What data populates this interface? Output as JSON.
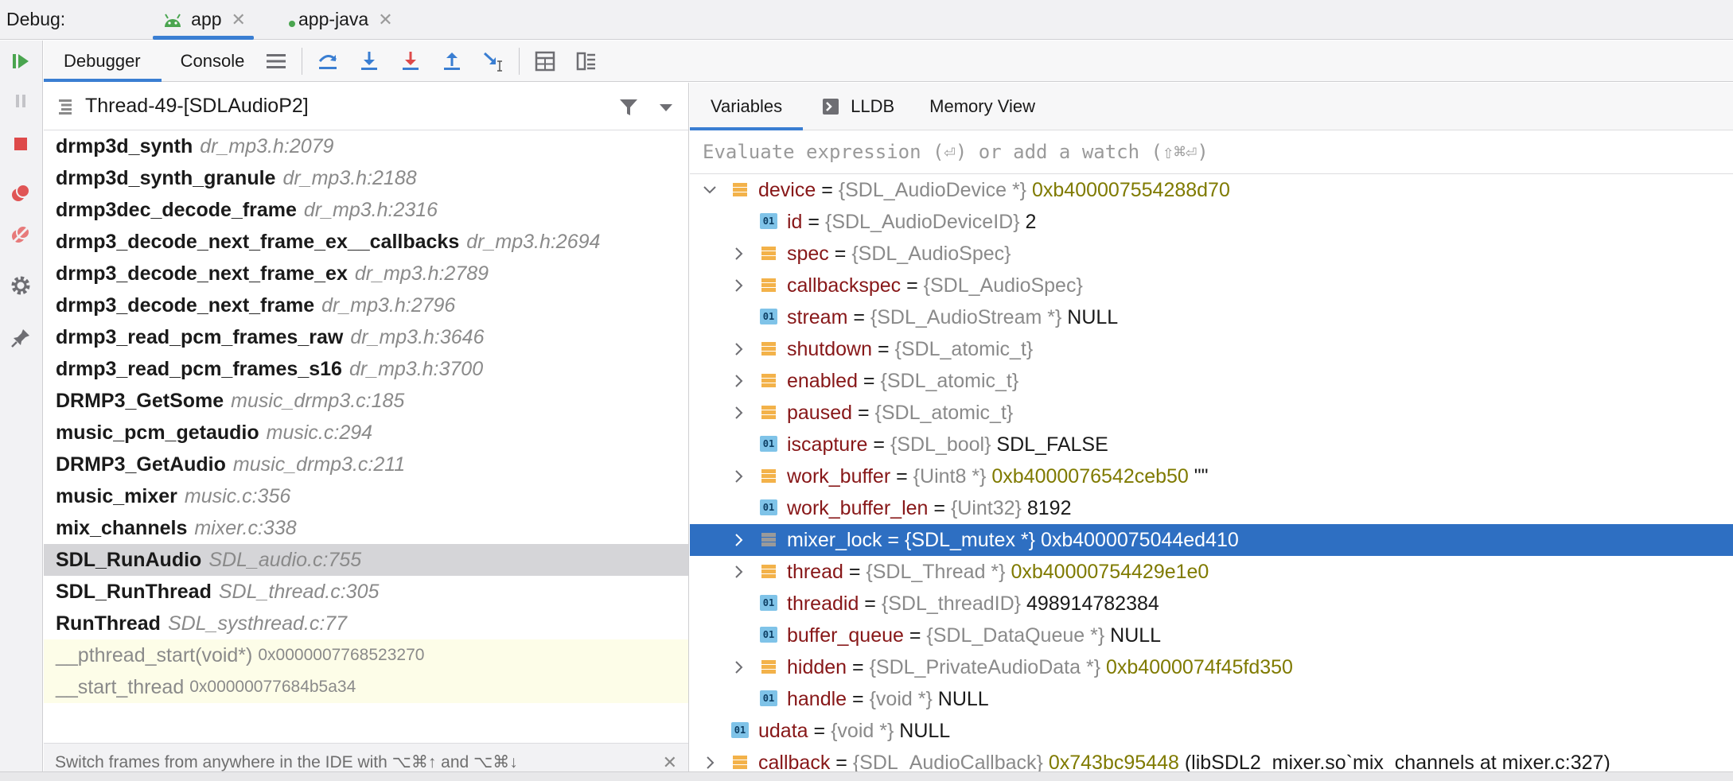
{
  "header": {
    "debug_label": "Debug:",
    "tabs": [
      {
        "label": "app",
        "close": "✕"
      },
      {
        "label": "app-java",
        "close": "✕"
      }
    ]
  },
  "toolbar": {
    "debugger_tab": "Debugger",
    "console_tab": "Console"
  },
  "frames_panel": {
    "thread": "Thread-49-[SDLAudioP2]",
    "frames": [
      {
        "fn": "drmp3d_synth",
        "loc": "dr_mp3.h:2079"
      },
      {
        "fn": "drmp3d_synth_granule",
        "loc": "dr_mp3.h:2188"
      },
      {
        "fn": "drmp3dec_decode_frame",
        "loc": "dr_mp3.h:2316"
      },
      {
        "fn": "drmp3_decode_next_frame_ex__callbacks",
        "loc": "dr_mp3.h:2694"
      },
      {
        "fn": "drmp3_decode_next_frame_ex",
        "loc": "dr_mp3.h:2789"
      },
      {
        "fn": "drmp3_decode_next_frame",
        "loc": "dr_mp3.h:2796"
      },
      {
        "fn": "drmp3_read_pcm_frames_raw",
        "loc": "dr_mp3.h:3646"
      },
      {
        "fn": "drmp3_read_pcm_frames_s16",
        "loc": "dr_mp3.h:3700"
      },
      {
        "fn": "DRMP3_GetSome",
        "loc": "music_drmp3.c:185"
      },
      {
        "fn": "music_pcm_getaudio",
        "loc": "music.c:294"
      },
      {
        "fn": "DRMP3_GetAudio",
        "loc": "music_drmp3.c:211"
      },
      {
        "fn": "music_mixer",
        "loc": "music.c:356"
      },
      {
        "fn": "mix_channels",
        "loc": "mixer.c:338"
      },
      {
        "fn": "SDL_RunAudio",
        "loc": "SDL_audio.c:755"
      },
      {
        "fn": "SDL_RunThread",
        "loc": "SDL_thread.c:305"
      },
      {
        "fn": "RunThread",
        "loc": "SDL_systhread.c:77"
      },
      {
        "fn": "__pthread_start(void*)",
        "loc": "0x0000007768523270"
      },
      {
        "fn": "__start_thread",
        "loc": "0x00000077684b5a34"
      }
    ],
    "hint": "Switch frames from anywhere in the IDE with ⌥⌘↑ and ⌥⌘↓",
    "hint_close": "✕"
  },
  "vars_panel": {
    "tabs": [
      "Variables",
      "LLDB",
      "Memory View"
    ],
    "eval_placeholder": "Evaluate expression (⏎) or add a watch (⇧⌘⏎)",
    "rows": [
      {
        "name": "device",
        "type": "{SDL_AudioDevice *}",
        "addr": "0xb400007554288d70",
        "val": ""
      },
      {
        "name": "id",
        "type": "{SDL_AudioDeviceID}",
        "addr": "",
        "val": "2"
      },
      {
        "name": "spec",
        "type": "{SDL_AudioSpec}",
        "addr": "",
        "val": ""
      },
      {
        "name": "callbackspec",
        "type": "{SDL_AudioSpec}",
        "addr": "",
        "val": ""
      },
      {
        "name": "stream",
        "type": "{SDL_AudioStream *}",
        "addr": "",
        "val": "NULL"
      },
      {
        "name": "shutdown",
        "type": "{SDL_atomic_t}",
        "addr": "",
        "val": ""
      },
      {
        "name": "enabled",
        "type": "{SDL_atomic_t}",
        "addr": "",
        "val": ""
      },
      {
        "name": "paused",
        "type": "{SDL_atomic_t}",
        "addr": "",
        "val": ""
      },
      {
        "name": "iscapture",
        "type": "{SDL_bool}",
        "addr": "",
        "val": "SDL_FALSE"
      },
      {
        "name": "work_buffer",
        "type": "{Uint8 *}",
        "addr": "0xb4000076542ceb50",
        "val": "\"\""
      },
      {
        "name": "work_buffer_len",
        "type": "{Uint32}",
        "addr": "",
        "val": "8192"
      },
      {
        "name": "mixer_lock",
        "type": "{SDL_mutex *}",
        "addr": "0xb4000075044ed410",
        "val": ""
      },
      {
        "name": "thread",
        "type": "{SDL_Thread *}",
        "addr": "0xb40000754429e1e0",
        "val": ""
      },
      {
        "name": "threadid",
        "type": "{SDL_threadID}",
        "addr": "",
        "val": "498914782384"
      },
      {
        "name": "buffer_queue",
        "type": "{SDL_DataQueue *}",
        "addr": "",
        "val": "NULL"
      },
      {
        "name": "hidden",
        "type": "{SDL_PrivateAudioData *}",
        "addr": "0xb4000074f45fd350",
        "val": ""
      },
      {
        "name": "handle",
        "type": "{void *}",
        "addr": "",
        "val": "NULL"
      },
      {
        "name": "udata",
        "type": "{void *}",
        "addr": "",
        "val": "NULL"
      },
      {
        "name": "callback",
        "type": "{SDL_AudioCallback}",
        "addr": "0x743bc95448",
        "val": "(libSDL2_mixer.so`mix_channels at mixer.c:327)"
      }
    ]
  },
  "colors": {
    "accent": "#3a7ed2",
    "selection": "#2e6fc2",
    "var_name": "#871718",
    "address": "#7f7a00"
  }
}
